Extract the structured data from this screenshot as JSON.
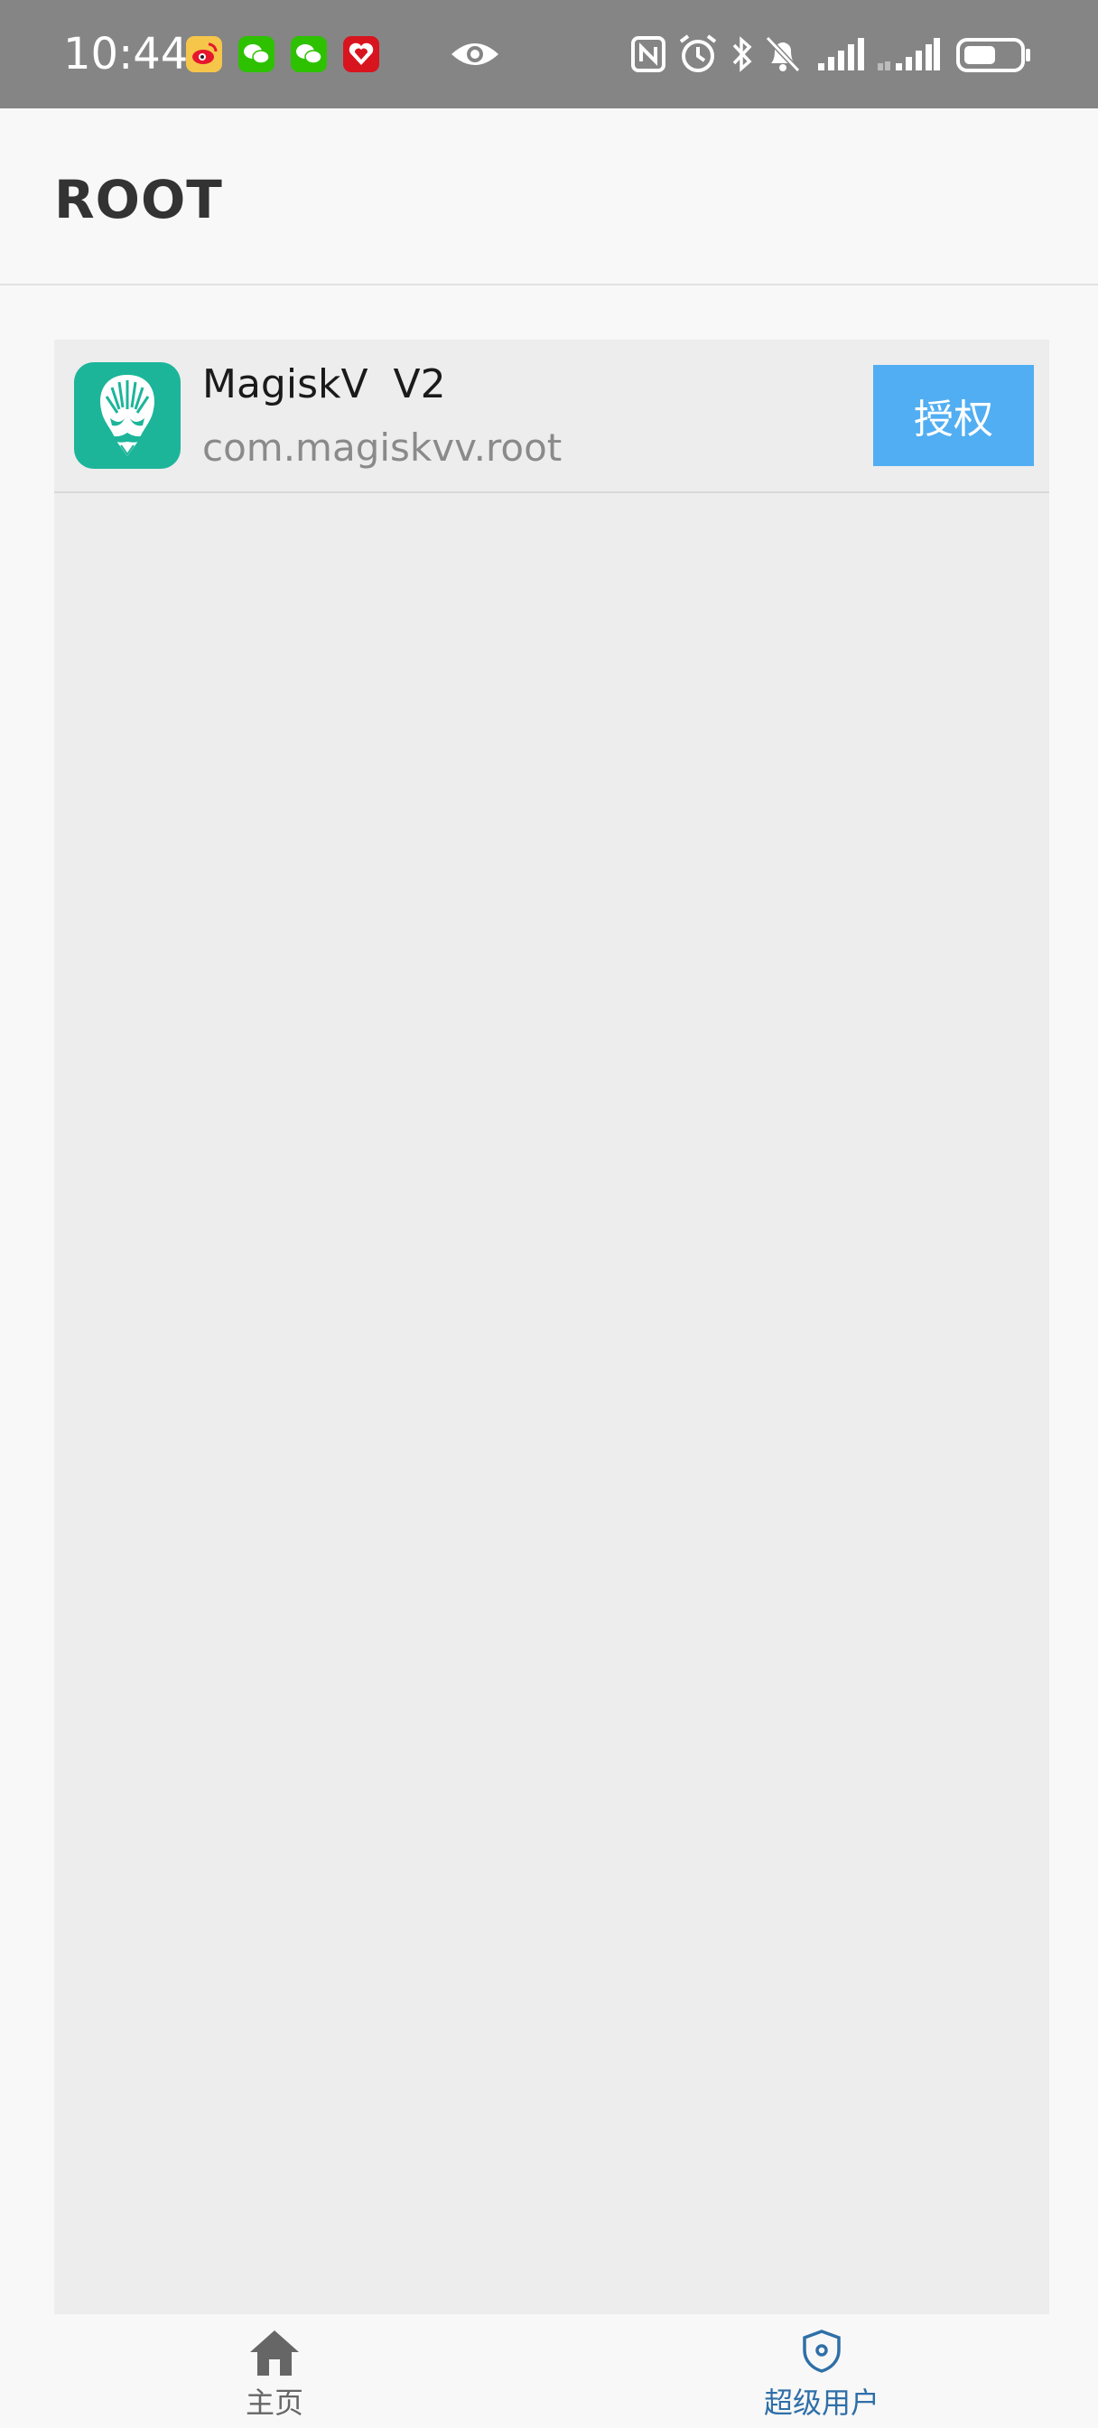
{
  "status_bar": {
    "time": "10:44",
    "notification_icons": [
      "weibo-icon",
      "wechat-icon",
      "wechat-icon",
      "heart-app-icon"
    ],
    "center_icon": "eye-icon",
    "system_icons": [
      "nfc-icon",
      "alarm-icon",
      "bluetooth-icon",
      "mute-bell-icon",
      "signal-icon",
      "signal-icon",
      "battery-icon"
    ]
  },
  "app_bar": {
    "title": "ROOT"
  },
  "apps": [
    {
      "name": "MagiskV  V2",
      "package": "com.magiskvv.root",
      "action_label": "授权",
      "icon": "magisk-mask-icon"
    }
  ],
  "bottom_nav": {
    "items": [
      {
        "label": "主页",
        "icon": "home-icon",
        "active": false
      },
      {
        "label": "超级用户",
        "icon": "shield-icon",
        "active": true
      }
    ]
  },
  "colors": {
    "status_bar": "#858585",
    "accent_button": "#52aef2",
    "nav_active": "#2f6fa8",
    "nav_inactive": "#666666",
    "app_icon_bg": "#1cb59a"
  }
}
